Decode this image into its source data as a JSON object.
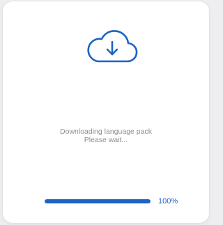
{
  "dialog": {
    "icon": "cloud-download-icon",
    "message_line1": "Downloading language pack",
    "message_line2": "Please wait...",
    "progress": {
      "percent": 100,
      "label": "100%"
    }
  },
  "colors": {
    "accent": "#1e62c4",
    "muted_text": "#8e8e93",
    "track": "#d7dbe3"
  }
}
